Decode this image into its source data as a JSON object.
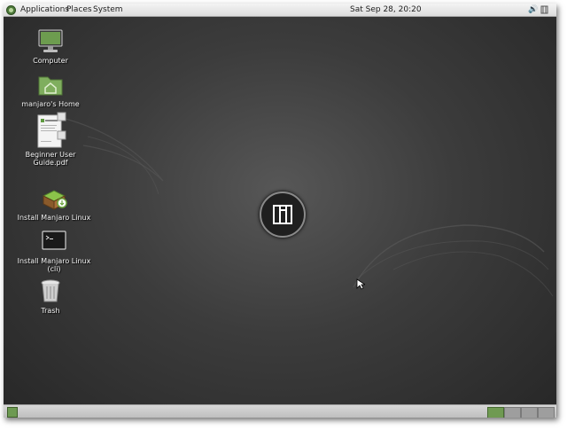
{
  "top_panel": {
    "menus": [
      "Applications",
      "Places",
      "System"
    ],
    "clock": "Sat Sep 28, 20:20"
  },
  "desktop": {
    "icons": [
      {
        "label": "Computer",
        "icon": "computer-icon"
      },
      {
        "label": "manjaro's Home",
        "icon": "home-folder-icon"
      },
      {
        "label": "Beginner User Guide.pdf",
        "icon": "pdf-document-icon"
      },
      {
        "label": "Install Manjaro Linux",
        "icon": "installer-icon"
      },
      {
        "label": "Install Manjaro Linux (cli)",
        "icon": "terminal-icon"
      },
      {
        "label": "Trash",
        "icon": "trash-icon"
      }
    ]
  },
  "bottom_panel": {
    "workspaces": 4,
    "active_workspace": 1
  },
  "colors": {
    "accent": "#6f9a52",
    "desktop_bg": "#3c3c3c",
    "panel_bg": "#dcdcdc"
  }
}
